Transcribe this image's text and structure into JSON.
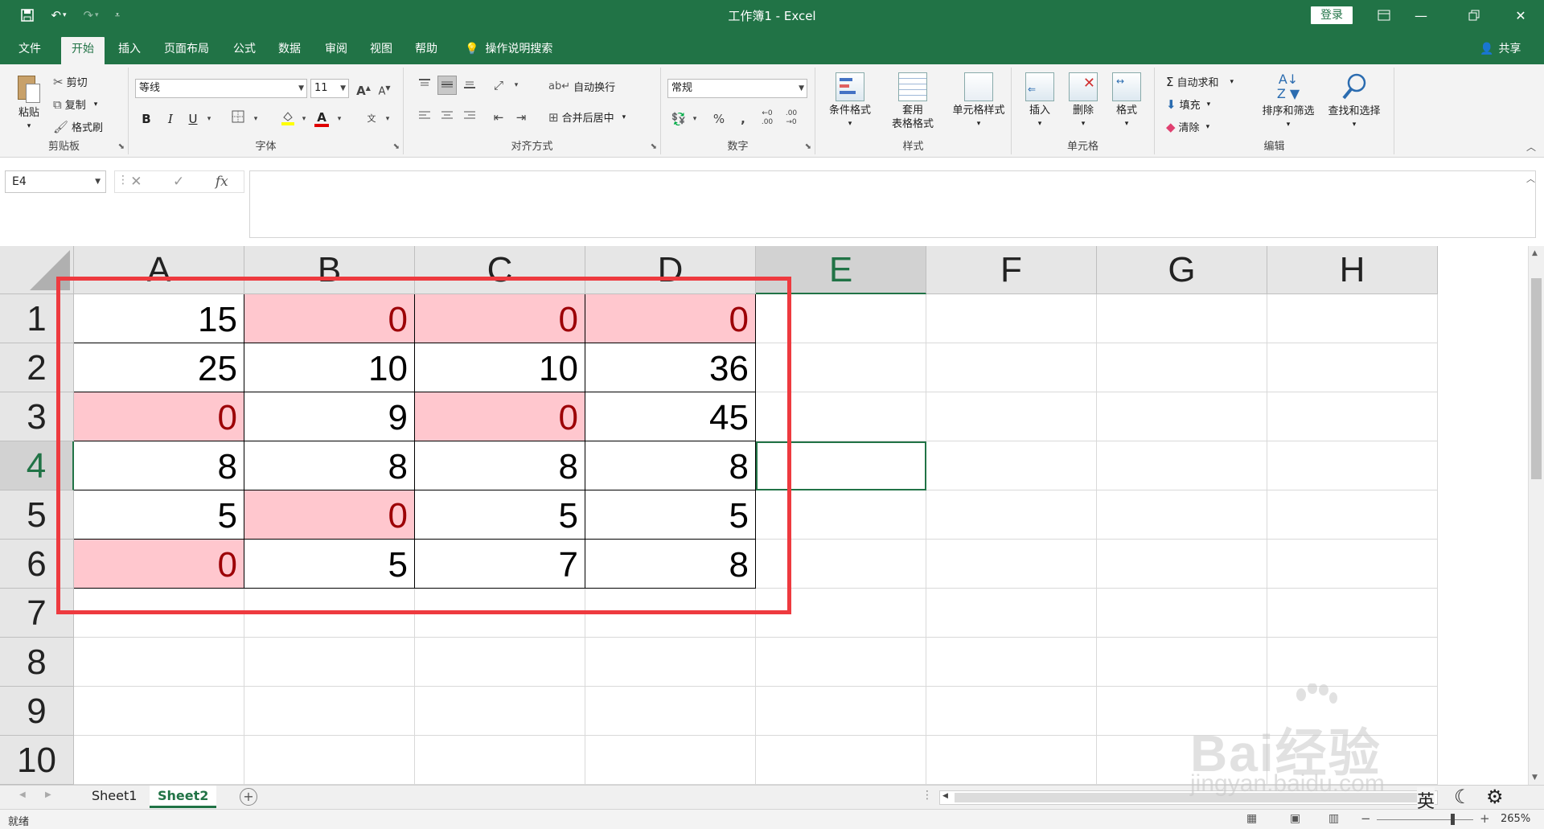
{
  "titlebar": {
    "title": "工作簿1  -  Excel",
    "login": "登录"
  },
  "menu": {
    "tabs": [
      "文件",
      "开始",
      "插入",
      "页面布局",
      "公式",
      "数据",
      "审阅",
      "视图",
      "帮助"
    ],
    "active_tab": "开始",
    "tell_me": "操作说明搜索",
    "share": "共享"
  },
  "ribbon": {
    "clipboard": {
      "label": "剪贴板",
      "paste": "粘贴",
      "cut": "剪切",
      "copy": "复制",
      "format_painter": "格式刷"
    },
    "font": {
      "label": "字体",
      "font_name": "等线",
      "font_size": "11"
    },
    "alignment": {
      "label": "对齐方式",
      "wrap_text": "自动换行",
      "merge_center": "合并后居中"
    },
    "number": {
      "label": "数字",
      "format": "常规"
    },
    "styles": {
      "label": "样式",
      "conditional": "条件格式",
      "table_line1": "套用",
      "table_line2": "表格格式",
      "cell_styles": "单元格样式"
    },
    "cells": {
      "label": "单元格",
      "insert": "插入",
      "delete": "删除",
      "format": "格式"
    },
    "editing": {
      "label": "编辑",
      "autosum": "自动求和",
      "fill": "填充",
      "clear": "清除",
      "sort_filter": "排序和筛选",
      "find_select": "查找和选择"
    }
  },
  "formula_bar": {
    "name_box": "E4",
    "formula": "",
    "fx": "fx"
  },
  "grid": {
    "columns": [
      "A",
      "B",
      "C",
      "D",
      "E",
      "F",
      "G",
      "H"
    ],
    "rows": [
      "1",
      "2",
      "3",
      "4",
      "5",
      "6",
      "7",
      "8",
      "9",
      "10"
    ],
    "selected_column": "E",
    "selected_row": "4",
    "data": [
      [
        "15",
        "0",
        "0",
        "0"
      ],
      [
        "25",
        "10",
        "10",
        "36"
      ],
      [
        "0",
        "9",
        "0",
        "45"
      ],
      [
        "8",
        "8",
        "8",
        "8"
      ],
      [
        "5",
        "0",
        "5",
        "5"
      ],
      [
        "0",
        "5",
        "7",
        "8"
      ]
    ],
    "highlight_color": "#ffc7ce",
    "highlight_text_color": "#9c0006",
    "annotation_color": "#ee3a3f"
  },
  "sheets": {
    "tabs": [
      "Sheet1",
      "Sheet2"
    ],
    "active": "Sheet2"
  },
  "status": {
    "ready": "就绪",
    "zoom": "265%"
  },
  "ime": {
    "lang": "英"
  },
  "watermark": {
    "line1": "Bai经验",
    "line2": "jingyan.baidu.com"
  },
  "colors": {
    "excel_green": "#217346"
  }
}
